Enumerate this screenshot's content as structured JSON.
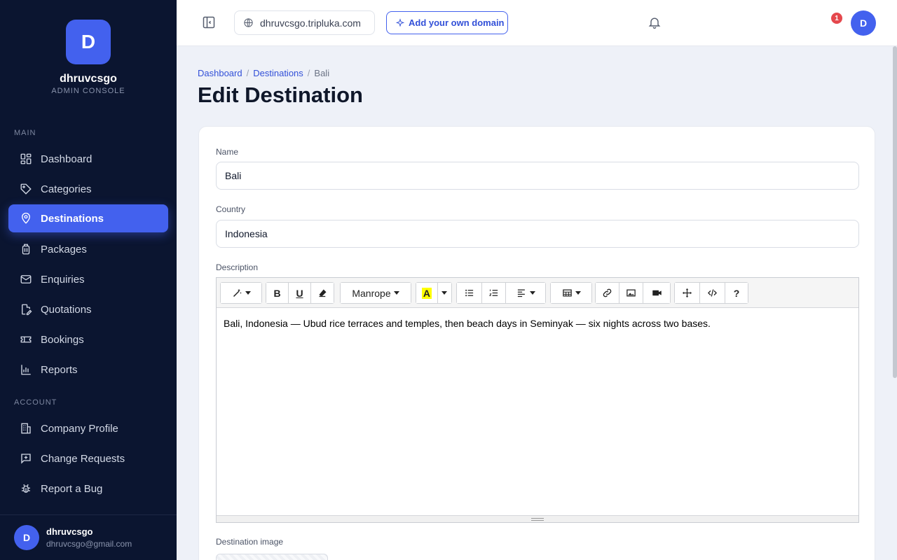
{
  "brand": {
    "initial": "D",
    "name": "dhruvcsgo",
    "subtitle": "ADMIN CONSOLE"
  },
  "sidebar": {
    "main_label": "MAIN",
    "main_items": [
      {
        "label": "Dashboard",
        "icon": "grid-icon"
      },
      {
        "label": "Categories",
        "icon": "tag-icon"
      },
      {
        "label": "Destinations",
        "icon": "map-pin-icon",
        "active": true
      },
      {
        "label": "Packages",
        "icon": "luggage-icon"
      },
      {
        "label": "Enquiries",
        "icon": "mail-icon"
      },
      {
        "label": "Quotations",
        "icon": "file-edit-icon"
      },
      {
        "label": "Bookings",
        "icon": "ticket-icon"
      },
      {
        "label": "Reports",
        "icon": "bar-chart-icon"
      }
    ],
    "account_label": "ACCOUNT",
    "account_items": [
      {
        "label": "Company Profile",
        "icon": "building-icon"
      },
      {
        "label": "Change Requests",
        "icon": "message-plus-icon"
      },
      {
        "label": "Report a Bug",
        "icon": "bug-icon"
      }
    ],
    "user": {
      "initial": "D",
      "name": "dhruvcsgo",
      "email": "dhruvcsgo@gmail.com"
    }
  },
  "topbar": {
    "domain": "dhruvcsgo.tripluka.com",
    "add_domain_label": "Add your own domain",
    "notification_count": "1",
    "avatar_initial": "D"
  },
  "breadcrumb": {
    "items": [
      "Dashboard",
      "Destinations"
    ],
    "current": "Bali",
    "separator": "/"
  },
  "page_title": "Edit Destination",
  "form": {
    "name_label": "Name",
    "name_value": "Bali",
    "country_label": "Country",
    "country_value": "Indonesia",
    "description_label": "Description",
    "editor_font": "Manrope",
    "description_text": "Bali, Indonesia — Ubud rice terraces and temples, then beach days in Seminyak — six nights across two bases.",
    "image_label": "Destination image"
  },
  "colors": {
    "accent": "#4361ee",
    "sidebar_bg": "#0b1530",
    "badge": "#e5484d"
  }
}
